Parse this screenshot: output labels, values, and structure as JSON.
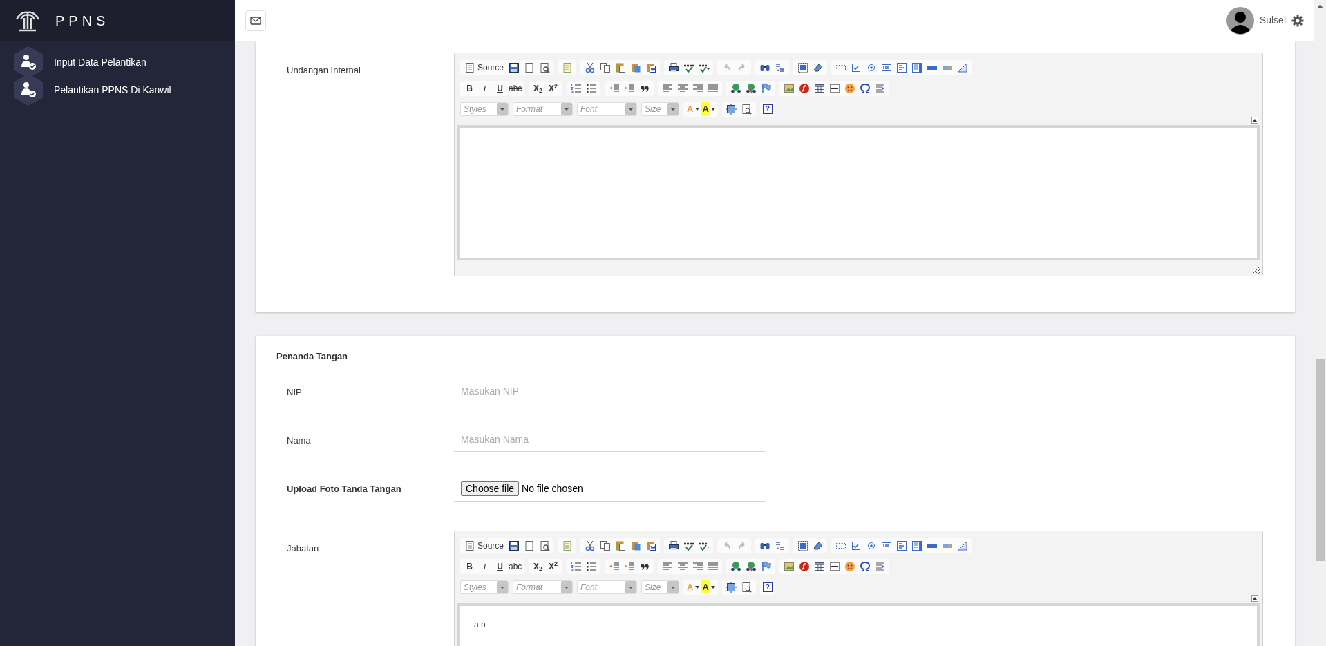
{
  "app": {
    "brand": "PPNS"
  },
  "sidebar": {
    "items": [
      {
        "label": "Input Data Pelantikan"
      },
      {
        "label": "Pelantikan PPNS Di Kanwil"
      }
    ]
  },
  "header": {
    "user": "Sulsel"
  },
  "undangan": {
    "label": "Undangan Internal",
    "editor": {
      "source": "Source",
      "format_buttons": [
        "B",
        "I",
        "U",
        "abc"
      ],
      "script_buttons": [
        "X$_{2}$",
        "X$^{2}$"
      ],
      "combos": [
        "Styles",
        "Format",
        "Font",
        "Size"
      ],
      "color_buttons": [
        "A",
        "A"
      ],
      "about": "?"
    }
  },
  "penanda_tangan": {
    "title": "Penanda Tangan",
    "fields": [
      {
        "kind": "text",
        "label": "NIP",
        "placeholder": "Masukan NIP"
      },
      {
        "kind": "text",
        "label": "Nama",
        "placeholder": "Masukan Nama"
      },
      {
        "kind": "file",
        "label": "Upload Foto Tanda Tangan",
        "button": "Choose file",
        "status": "No file chosen"
      }
    ],
    "jabatan": {
      "label": "Jabatan",
      "editor": {
        "source": "Source",
        "format_buttons": [
          "B",
          "I",
          "U",
          "abc"
        ],
        "script_buttons": [
          "X$_{2}$",
          "X$^{2}$"
        ],
        "combos": [
          "Styles",
          "Format",
          "Font",
          "Size"
        ],
        "color_buttons": [
          "A",
          "A"
        ],
        "about": "?",
        "content": "a.n"
      }
    }
  }
}
